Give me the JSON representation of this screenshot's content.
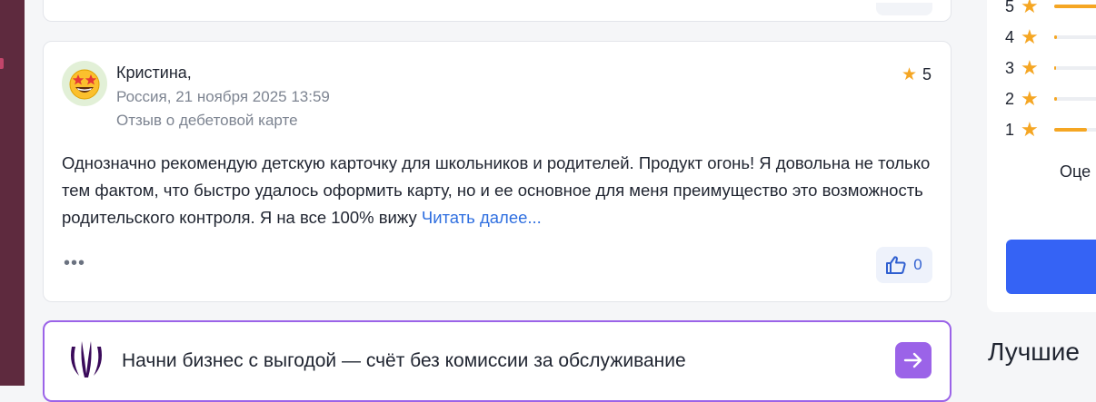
{
  "review": {
    "author": "Кристина,",
    "meta": "Россия, 21 ноября 2025 13:59",
    "type": "Отзыв о дебетовой карте",
    "rating": "5",
    "text": "Однозначно рекомендую детскую карточку для школьников и родителей. Продукт огонь! Я довольна не только тем фактом, что быстро удалось оформить карту, но и ее основное для меня преимущество это возможность родительского контроля. Я на все 100% вижу ",
    "read_more": "Читать далее...",
    "more": "•••",
    "likes": "0",
    "avatar_icon": "star-struck-emoji-icon"
  },
  "ad": {
    "text": "Начни бизнес с выгодой — счёт без комиссии за обслуживание",
    "logo_icon": "bank-logo-icon",
    "arrow_icon": "arrow-right-icon",
    "border_color": "#9b63e8"
  },
  "rating_summary": {
    "rows": [
      {
        "stars": "5",
        "share": 0.72
      },
      {
        "stars": "4",
        "share": 0.04
      },
      {
        "stars": "3",
        "share": 0.02
      },
      {
        "stars": "2",
        "share": 0.04
      },
      {
        "stars": "1",
        "share": 0.45
      }
    ],
    "label": "Оце",
    "accent_color": "#f5a623",
    "button_color": "#3563f5"
  },
  "best_heading": "Лучшие "
}
